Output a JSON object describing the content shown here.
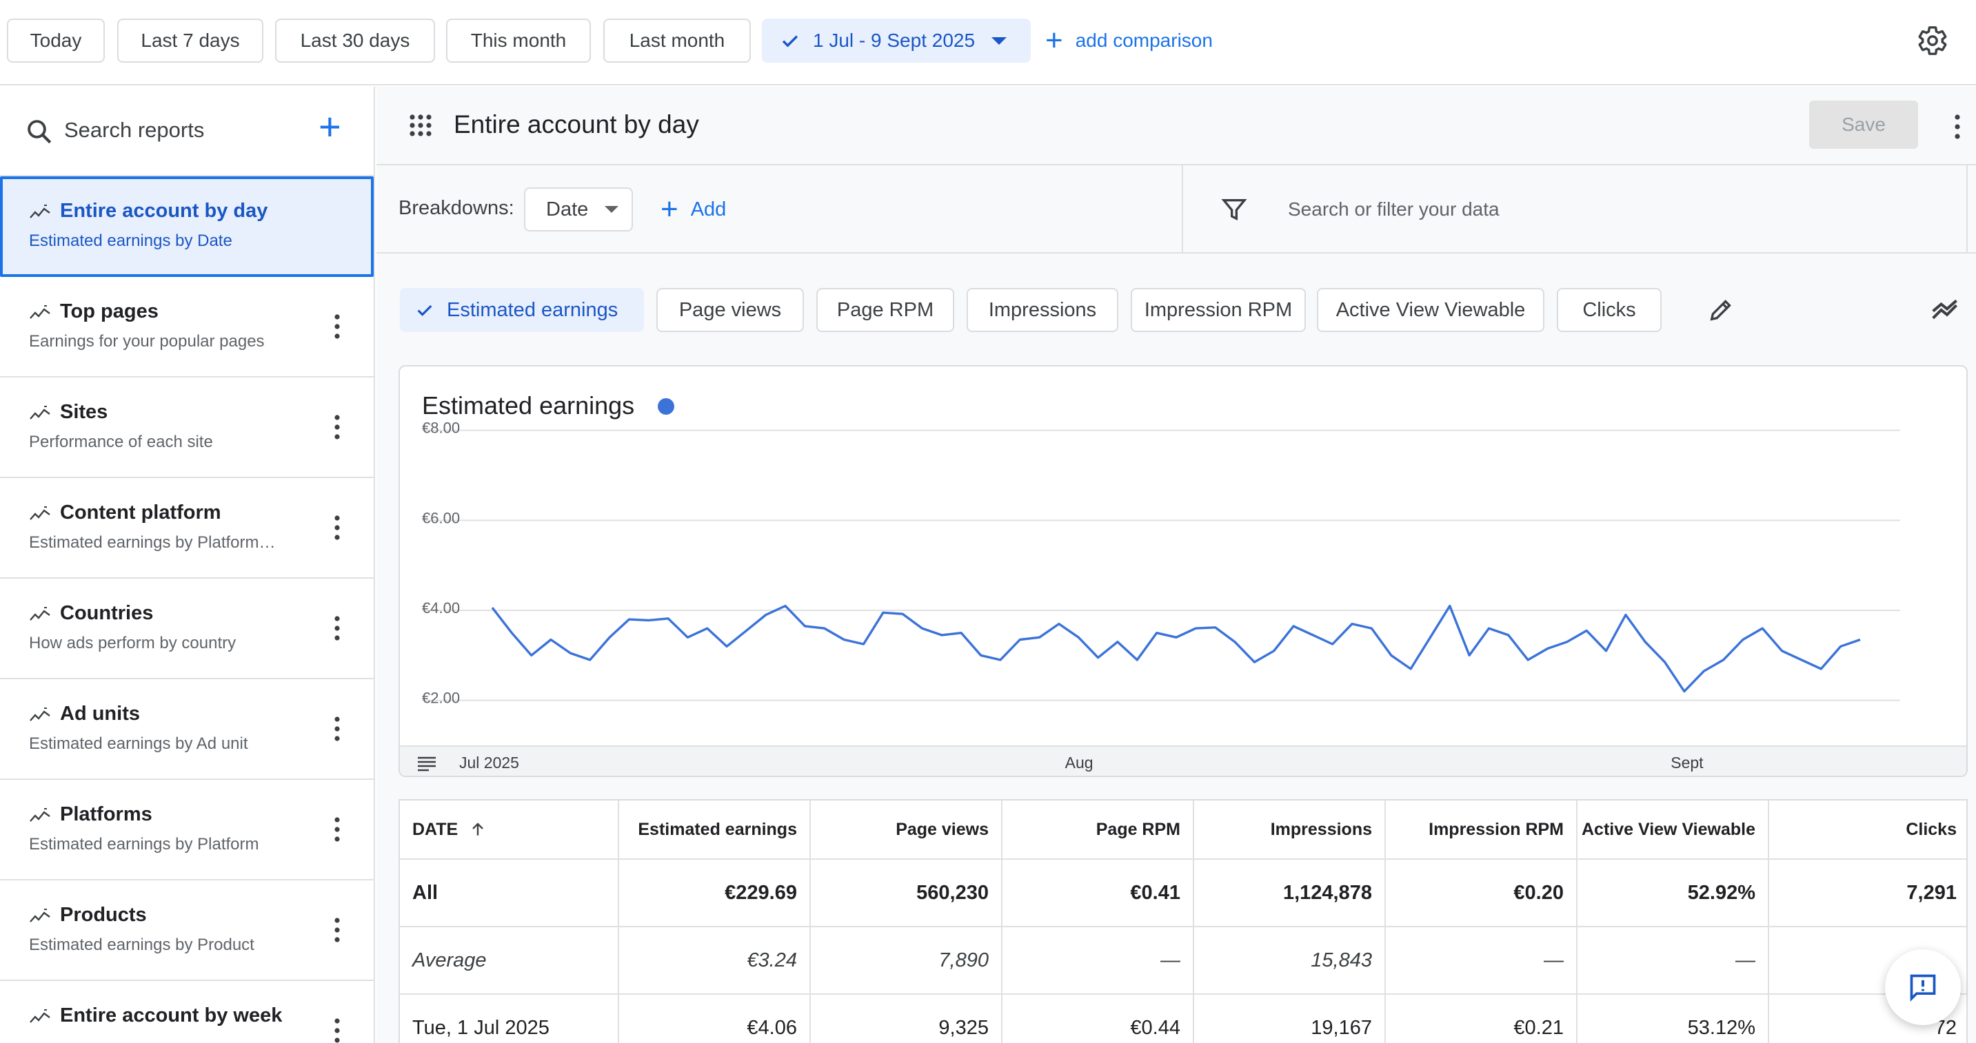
{
  "date_filters": [
    {
      "label": "Today"
    },
    {
      "label": "Last 7 days"
    },
    {
      "label": "Last 30 days"
    },
    {
      "label": "This month"
    },
    {
      "label": "Last month"
    }
  ],
  "date_range": {
    "label": "1 Jul - 9 Sept 2025",
    "selected": true
  },
  "add_comparison": "add comparison",
  "sidebar": {
    "search_placeholder": "Search reports",
    "items": [
      {
        "title": "Entire account by day",
        "subtitle": "Estimated earnings by Date",
        "active": true
      },
      {
        "title": "Top pages",
        "subtitle": "Earnings for your popular pages"
      },
      {
        "title": "Sites",
        "subtitle": "Performance of each site"
      },
      {
        "title": "Content platform",
        "subtitle": "Estimated earnings by Platform…"
      },
      {
        "title": "Countries",
        "subtitle": "How ads perform by country"
      },
      {
        "title": "Ad units",
        "subtitle": "Estimated earnings by Ad unit"
      },
      {
        "title": "Platforms",
        "subtitle": "Estimated earnings by Platform"
      },
      {
        "title": "Products",
        "subtitle": "Estimated earnings by Product"
      },
      {
        "title": "Entire account by week",
        "subtitle": ""
      }
    ]
  },
  "report": {
    "title": "Entire account by day",
    "save_label": "Save",
    "breakdowns_label": "Breakdowns:",
    "breakdown_value": "Date",
    "add_label": "Add",
    "filter_placeholder": "Search or filter your data"
  },
  "metrics": [
    {
      "label": "Estimated earnings",
      "selected": true
    },
    {
      "label": "Page views"
    },
    {
      "label": "Page RPM"
    },
    {
      "label": "Impressions"
    },
    {
      "label": "Impression RPM"
    },
    {
      "label": "Active View Viewable"
    },
    {
      "label": "Clicks"
    }
  ],
  "chart_data": {
    "type": "line",
    "title": "Estimated earnings",
    "y_tick_labels": [
      "€8.00",
      "€6.00",
      "€4.00",
      "€2.00"
    ],
    "y_ticks": [
      8,
      6,
      4,
      2
    ],
    "ylim": [
      1.0,
      8.5
    ],
    "x_tick_labels": [
      {
        "label": "Jul 2025",
        "index": 0
      },
      {
        "label": "Aug",
        "index": 31
      },
      {
        "label": "Sept",
        "index": 62
      }
    ],
    "grid": true,
    "series": [
      {
        "color": "#3b73d9",
        "values": [
          4.06,
          3.5,
          3.0,
          3.35,
          3.05,
          2.9,
          3.4,
          3.8,
          3.78,
          3.82,
          3.4,
          3.6,
          3.2,
          3.55,
          3.9,
          4.1,
          3.65,
          3.6,
          3.35,
          3.25,
          3.95,
          3.92,
          3.6,
          3.45,
          3.5,
          3.0,
          2.9,
          3.35,
          3.4,
          3.7,
          3.4,
          2.95,
          3.3,
          2.9,
          3.5,
          3.4,
          3.6,
          3.62,
          3.3,
          2.85,
          3.1,
          3.65,
          3.45,
          3.25,
          3.7,
          3.6,
          3.0,
          2.7,
          3.4,
          4.1,
          3.0,
          3.6,
          3.45,
          2.9,
          3.15,
          3.3,
          3.55,
          3.1,
          3.9,
          3.3,
          2.85,
          2.2,
          2.65,
          2.9,
          3.35,
          3.6,
          3.1,
          2.9,
          2.7,
          3.2,
          3.35
        ]
      }
    ]
  },
  "table": {
    "columns": [
      "DATE",
      "Estimated earnings",
      "Page views",
      "Page RPM",
      "Impressions",
      "Impression RPM",
      "Active View Viewable",
      "Clicks"
    ],
    "rows": [
      {
        "type": "all",
        "cells": [
          "All",
          "€229.69",
          "560,230",
          "€0.41",
          "1,124,878",
          "€0.20",
          "52.92%",
          "7,291"
        ]
      },
      {
        "type": "avg",
        "cells": [
          "Average",
          "€3.24",
          "7,890",
          "—",
          "15,843",
          "—",
          "—",
          ""
        ]
      },
      {
        "type": "day",
        "cells": [
          "Tue, 1 Jul 2025",
          "€4.06",
          "9,325",
          "€0.44",
          "19,167",
          "€0.21",
          "53.12%",
          "72"
        ]
      }
    ]
  },
  "icons": {
    "search": "search-icon",
    "settings": "gear-icon",
    "apps": "apps-grid-icon",
    "filter": "filter-icon",
    "edit": "pencil-icon",
    "trend": "trend-icon",
    "feedback": "feedback-icon"
  },
  "colors": {
    "accent": "#1a73e8",
    "series": "#3b73d9"
  }
}
